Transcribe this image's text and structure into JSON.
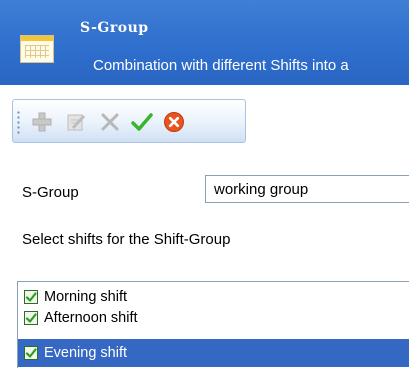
{
  "header": {
    "title": "S-Group",
    "subtitle": "Combination with different Shifts into a",
    "icon": "calendar-icon"
  },
  "toolbar": {
    "buttons": [
      {
        "name": "add",
        "icon": "plus-icon",
        "enabled": false
      },
      {
        "name": "edit",
        "icon": "edit-icon",
        "enabled": false
      },
      {
        "name": "delete",
        "icon": "x-icon",
        "enabled": false
      },
      {
        "name": "confirm",
        "icon": "checkmark-icon",
        "enabled": true
      },
      {
        "name": "cancel",
        "icon": "cancel-icon",
        "enabled": true
      }
    ]
  },
  "form": {
    "group_label": "S-Group",
    "group_value": "working group",
    "shifts_label": "Select shifts for the Shift-Group"
  },
  "shifts": [
    {
      "label": "Morning shift",
      "checked": true,
      "selected": false
    },
    {
      "label": "Afternoon shift",
      "checked": true,
      "selected": false
    },
    {
      "label": "Evening shift",
      "checked": true,
      "selected": true
    }
  ],
  "colors": {
    "header_bg": "#2f6fcd",
    "selection_bg": "#3468c3",
    "check_green": "#2e9b22",
    "confirm_green": "#39b52a",
    "cancel_orange": "#e8531f"
  }
}
